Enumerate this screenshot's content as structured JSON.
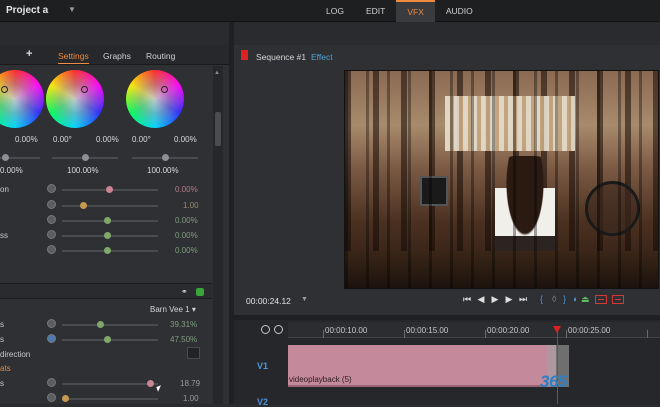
{
  "app": {
    "project": "Project a"
  },
  "top_tabs": [
    "LOG",
    "EDIT",
    "VFX",
    "AUDIO"
  ],
  "active_tab": "VFX",
  "left_panel": {
    "add_label": "+",
    "tabs": [
      "Settings",
      "Graphs",
      "Routing"
    ],
    "active_tab": "Settings",
    "wheels": [
      {
        "angle": "",
        "pct": "0.00%",
        "bottom": "0.00%"
      },
      {
        "angle": "0.00°",
        "pct": "0.00%",
        "bottom": "100.00%"
      },
      {
        "angle": "0.00°",
        "pct": "0.00%",
        "bottom": "100.00%"
      }
    ],
    "rows": [
      {
        "label": "on",
        "value": "0.00%"
      },
      {
        "label": "",
        "value": "1.00"
      },
      {
        "label": "",
        "value": "0.00%"
      },
      {
        "label": "ss",
        "value": "0.00%"
      },
      {
        "label": "",
        "value": "0.00%"
      }
    ],
    "transition": {
      "preset": "Barn Vee 1",
      "rows": [
        {
          "label": "s",
          "value": "39.31%"
        },
        {
          "label": "s",
          "value": "47.50%"
        },
        {
          "label": "direction",
          "value": ""
        },
        {
          "label": "ats",
          "value": ""
        },
        {
          "label": "s",
          "value": "18.79"
        },
        {
          "label": "",
          "value": "1.00"
        }
      ]
    }
  },
  "viewer": {
    "sequence": "Sequence #1",
    "mode": "Effect",
    "timecode": "00:00:24.12"
  },
  "timeline": {
    "ticks": [
      "00:00:10.00",
      "00:00:15.00",
      "00:00:20.00",
      "00:00:25.00"
    ],
    "tracks": [
      "V1",
      "V2"
    ],
    "clip": "videoplayback (5)"
  },
  "watermark": "365",
  "icons": {
    "transport": [
      "skip-start-icon",
      "step-back-icon",
      "play-icon",
      "step-forward-icon",
      "skip-end-icon"
    ]
  },
  "colors": {
    "accent": "#f08a3c",
    "link": "#4fa3d6",
    "clip": "#c48a9c",
    "playhead": "#dd2222"
  }
}
